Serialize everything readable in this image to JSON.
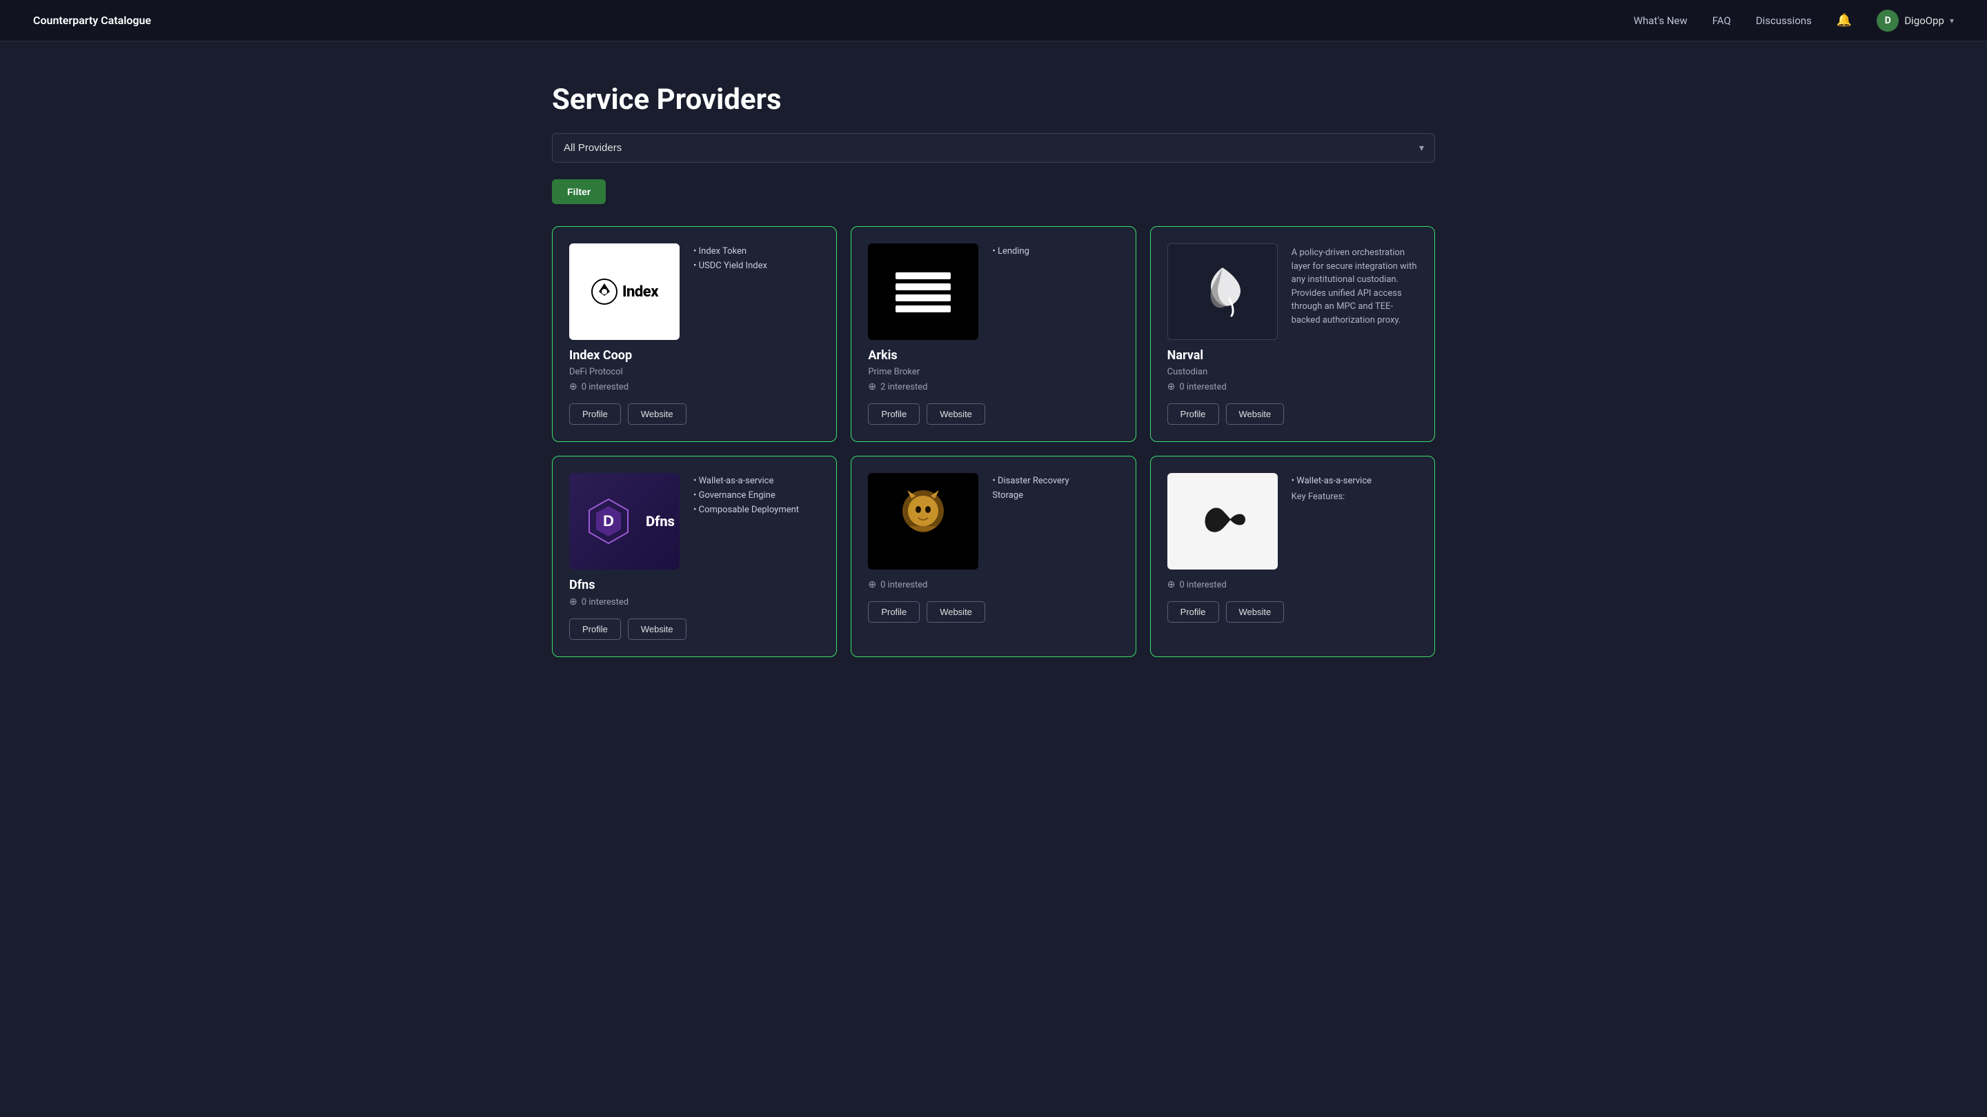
{
  "nav": {
    "logo": "Counterparty Catalogue",
    "links": [
      {
        "id": "whats-new",
        "label": "What's New"
      },
      {
        "id": "faq",
        "label": "FAQ"
      },
      {
        "id": "discussions",
        "label": "Discussions"
      }
    ],
    "user": {
      "initial": "D",
      "name": "DigoOpp"
    }
  },
  "page": {
    "title": "Service Providers",
    "dropdown": {
      "value": "All Providers",
      "placeholder": "All Providers"
    },
    "filter_label": "Filter"
  },
  "cards": [
    {
      "id": "index-coop",
      "name": "Index Coop",
      "type": "DeFi Protocol",
      "interested": 0,
      "tags": [
        "Index Token",
        "USDC Yield Index"
      ],
      "description": "",
      "profile_label": "Profile",
      "website_label": "Website",
      "logo_type": "index"
    },
    {
      "id": "arkis",
      "name": "Arkis",
      "type": "Prime Broker",
      "interested": 2,
      "tags": [
        "Lending"
      ],
      "description": "",
      "profile_label": "Profile",
      "website_label": "Website",
      "logo_type": "arkis"
    },
    {
      "id": "narval",
      "name": "Narval",
      "type": "Custodian",
      "interested": 0,
      "tags": [],
      "description": "A policy-driven orchestration layer for secure integration with any institutional custodian. Provides unified API access through an MPC and TEE-backed authorization proxy.",
      "profile_label": "Profile",
      "website_label": "Website",
      "logo_type": "narval"
    },
    {
      "id": "dfns",
      "name": "Dfns",
      "type": "",
      "interested": 0,
      "tags": [
        "Wallet-as-a-service",
        "Governance Engine",
        "Composable Deployment"
      ],
      "description": "",
      "profile_label": "Profile",
      "website_label": "Website",
      "logo_type": "dfns"
    },
    {
      "id": "lion",
      "name": "",
      "type": "",
      "interested": 0,
      "tags": [
        "Disaster Recovery",
        "Storage"
      ],
      "description": "",
      "profile_label": "Profile",
      "website_label": "Website",
      "logo_type": "lion"
    },
    {
      "id": "last",
      "name": "",
      "type": "",
      "interested": 0,
      "tags": [
        "Wallet-as-a-service"
      ],
      "description": "Key Features:",
      "profile_label": "Profile",
      "website_label": "Website",
      "logo_type": "last"
    }
  ]
}
